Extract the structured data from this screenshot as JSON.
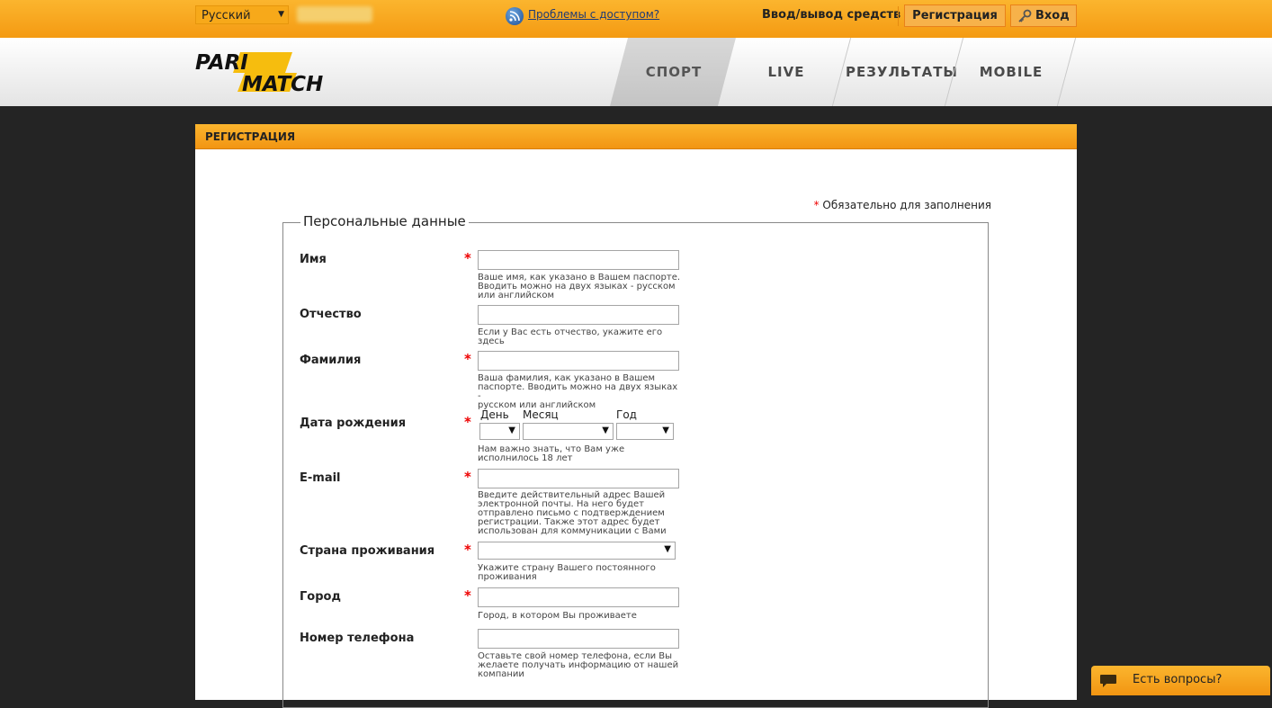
{
  "topbar": {
    "language": "Русский",
    "access_link": "Проблемы с доступом?",
    "deposit": "Ввод/вывод средств",
    "register": "Регистрация",
    "login": "Вход"
  },
  "logo": {
    "line1": "PARI",
    "line2": "MATCH"
  },
  "nav": {
    "sport": "СПОРТ",
    "live": "LIVE",
    "results": "РЕЗУЛЬТАТЫ",
    "mobile": "MOBILE",
    "active": "СПОРТ"
  },
  "panel": {
    "title": "РЕГИСТРАЦИЯ",
    "required_star": "*",
    "required_note": "Обязательно для заполнения",
    "section_title": "Персональные данные"
  },
  "form": {
    "first_name": {
      "label": "Имя",
      "hint": [
        "Ваше имя, как указано в Вашем паспорте.",
        "Вводить можно на двух языках - русском",
        "или английском"
      ]
    },
    "patronymic": {
      "label": "Отчество",
      "hint": [
        "Если у Вас есть отчество, укажите его",
        "здесь"
      ]
    },
    "last_name": {
      "label": "Фамилия",
      "hint": [
        "Ваша фамилия, как указано в Вашем",
        "паспорте. Вводить можно на двух языках -",
        "русском или английском"
      ]
    },
    "birth_date": {
      "label": "Дата рождения",
      "day": "День",
      "month": "Месяц",
      "year": "Год",
      "hint": [
        "Нам важно знать, что Вам уже",
        "исполнилось 18 лет"
      ]
    },
    "email": {
      "label": "E-mail",
      "hint": [
        "Введите действительный адрес Вашей",
        "электронной почты. На него будет",
        "отправлено письмо с подтверждением",
        "регистрации. Также этот адрес будет",
        "использован для коммуникации с Вами"
      ]
    },
    "country": {
      "label": "Страна проживания",
      "hint": [
        "Укажите страну Вашего постоянного",
        "проживания"
      ]
    },
    "city": {
      "label": "Город",
      "hint": [
        "Город, в котором Вы проживаете"
      ]
    },
    "phone": {
      "label": "Номер телефона",
      "hint": [
        "Оставьте свой номер телефона, если Вы",
        "желаете получать информацию от нашей",
        "компании"
      ]
    }
  },
  "chat": {
    "label": "Есть вопросы?"
  },
  "colors": {
    "orange": "#f7a91a",
    "required": "#e00000"
  }
}
